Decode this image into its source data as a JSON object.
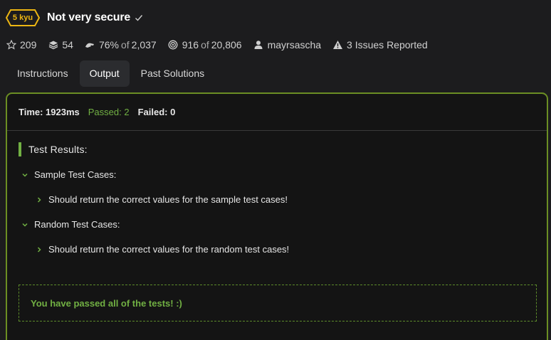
{
  "header": {
    "rank": "5 kyu",
    "title": "Not very secure",
    "rank_color": "#ecb613"
  },
  "stats": {
    "stars": "209",
    "collections": "54",
    "satisfaction_pct": "76%",
    "satisfaction_of": "of",
    "satisfaction_votes": "2,037",
    "completed": "916",
    "completed_of": "of",
    "completed_total": "20,806",
    "author": "mayrsascha",
    "issues": "3 Issues Reported",
    "icons": [
      "star-icon",
      "stack-icon",
      "hand-icon",
      "target-icon",
      "user-icon",
      "warning-icon"
    ]
  },
  "tabs": [
    {
      "label": "Instructions",
      "active": false
    },
    {
      "label": "Output",
      "active": true
    },
    {
      "label": "Past Solutions",
      "active": false
    }
  ],
  "output": {
    "time_label": "Time: 1923ms",
    "passed_label": "Passed: 2",
    "failed_label": "Failed: 0",
    "results_heading": "Test Results:",
    "groups": [
      {
        "name": "Sample Test Cases:",
        "case": "Should return the correct values for the sample test cases!"
      },
      {
        "name": "Random Test Cases:",
        "case": "Should return the correct values for the random test cases!"
      }
    ],
    "success_message": "You have passed all of the tests! :)",
    "accent_color": "#71b043",
    "border_color": "#6b8e23"
  }
}
